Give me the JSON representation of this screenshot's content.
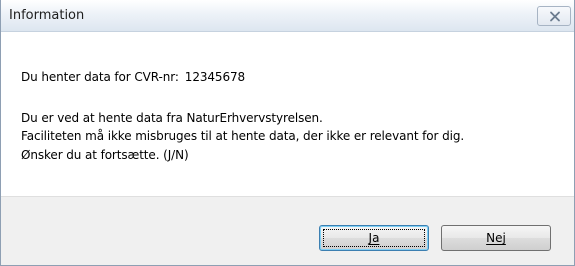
{
  "window": {
    "title": "Information"
  },
  "message": {
    "cvr_label": "Du henter data for CVR-nr:",
    "cvr_value": "12345678",
    "line_source": "Du er ved at hente data fra NaturErhvervstyrelsen.",
    "line_warning": "Faciliteten må ikke misbruges til at hente data, der ikke er relevant for dig.",
    "line_question": "Ønsker du at fortsætte. (J/N)"
  },
  "buttons": {
    "yes_label": "Ja",
    "no_label": "Nej"
  },
  "icons": {
    "close": "close-icon"
  },
  "colors": {
    "titlebar": "#dde6f0",
    "footer": "#f0f0f0",
    "focus_border": "#3c7fb1"
  }
}
